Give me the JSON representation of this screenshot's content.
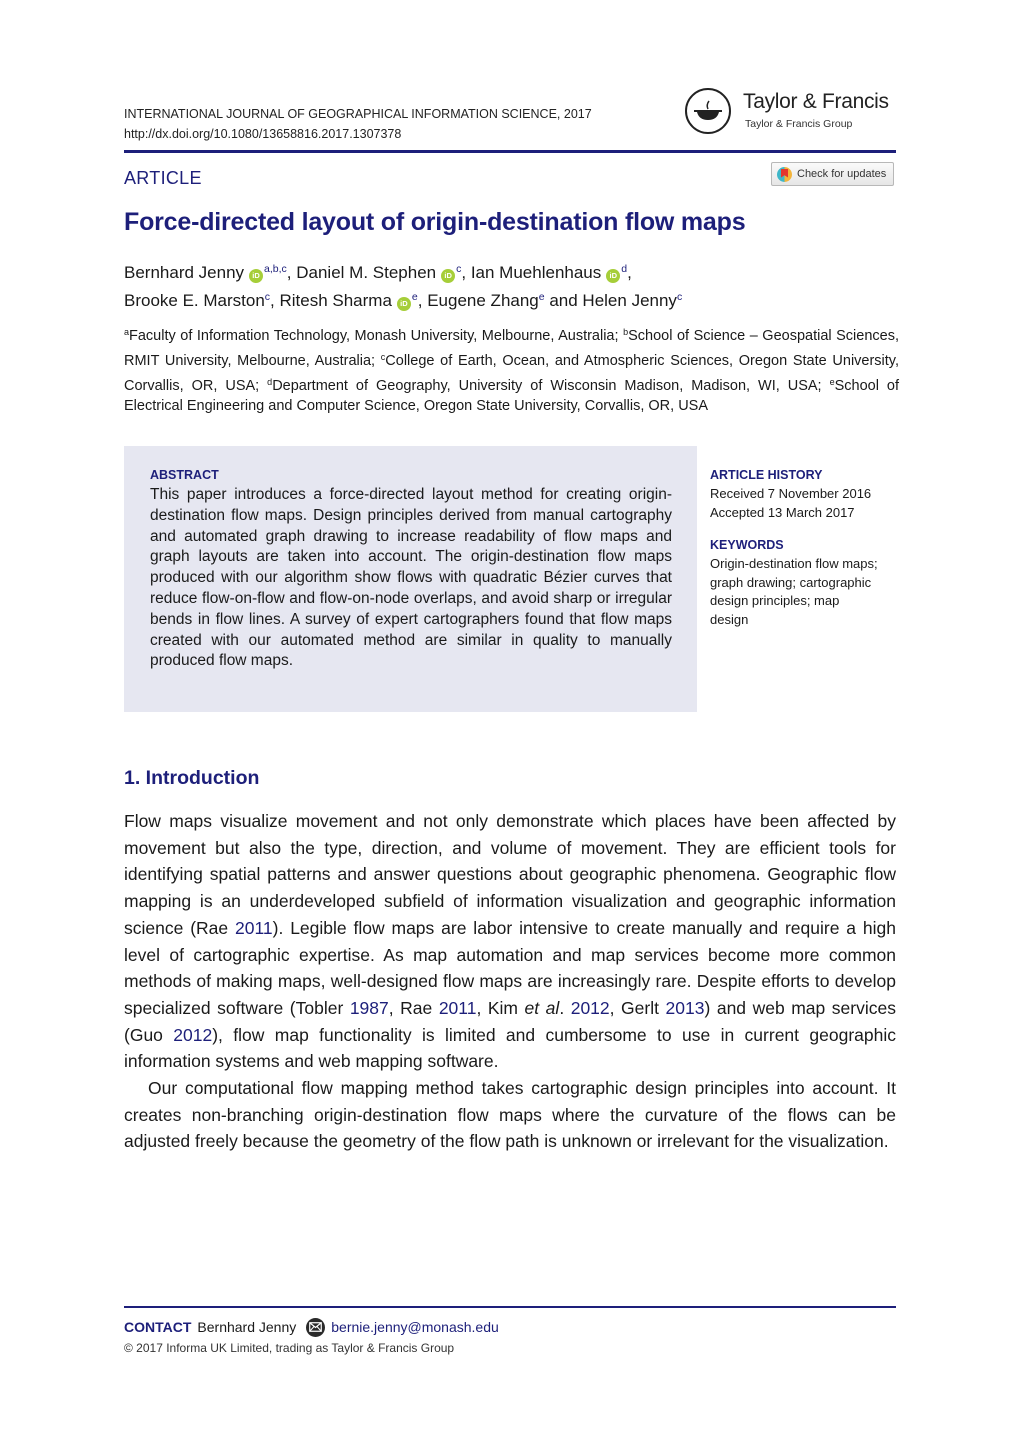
{
  "header": {
    "journal": "INTERNATIONAL JOURNAL OF GEOGRAPHICAL INFORMATION SCIENCE, 2017",
    "doi": "http://dx.doi.org/10.1080/13658816.2017.1307378",
    "publisher": {
      "name": "Taylor & Francis",
      "group": "Taylor & Francis Group",
      "logo_icon": "lamp-icon"
    },
    "article_type": "ARTICLE",
    "check_updates_label": "Check for updates"
  },
  "title": "Force-directed layout of origin-destination flow maps",
  "authors": [
    {
      "name": "Bernhard Jenny",
      "orcid": true,
      "affil": "a,b,c",
      "sep": ", "
    },
    {
      "name": "Daniel M. Stephen",
      "orcid": true,
      "affil": "c",
      "sep": ", "
    },
    {
      "name": "Ian Muehlenhaus",
      "orcid": true,
      "affil": "d",
      "sep": ","
    },
    {
      "name": "Brooke E. Marston",
      "orcid": false,
      "affil": "c",
      "sep": ", "
    },
    {
      "name": "Ritesh Sharma",
      "orcid": true,
      "affil": "e",
      "sep": ", "
    },
    {
      "name": "Eugene Zhang",
      "orcid": false,
      "affil": "e",
      "sep": " and "
    },
    {
      "name": "Helen Jenny",
      "orcid": false,
      "affil": "c",
      "sep": ""
    }
  ],
  "orcid_label": "iD",
  "affiliations": [
    {
      "key": "a",
      "text": "Faculty of Information Technology, Monash University, Melbourne, Australia; "
    },
    {
      "key": "b",
      "text": "School of Science – Geospatial Sciences, RMIT University, Melbourne, Australia; "
    },
    {
      "key": "c",
      "text": "College of Earth, Ocean, and Atmospheric Sciences, Oregon State University, Corvallis, OR, USA; "
    },
    {
      "key": "d",
      "text": "Department of Geography, University of Wisconsin Madison, Madison, WI, USA; "
    },
    {
      "key": "e",
      "text": "School of Electrical Engineering and Computer Science, Oregon State University, Corvallis, OR, USA"
    }
  ],
  "abstract": {
    "heading": "ABSTRACT",
    "text": "This paper introduces a force-directed layout method for creating origin-destination flow maps. Design principles derived from manual cartography and automated graph drawing to increase readability of flow maps and graph layouts are taken into account. The origin-destination flow maps produced with our algorithm show flows with quadratic Bézier curves that reduce flow-on-flow and flow-on-node overlaps, and avoid sharp or irregular bends in flow lines. A survey of expert cartographers found that flow maps created with our automated method are similar in quality to manually produced flow maps."
  },
  "article_history": {
    "heading": "ARTICLE HISTORY",
    "received": "Received 7 November 2016",
    "accepted": "Accepted 13 March 2017"
  },
  "keywords": {
    "heading": "KEYWORDS",
    "text": "Origin-destination flow maps; graph drawing; cartographic design principles; map design"
  },
  "introduction": {
    "heading": "1.  Introduction",
    "paragraphs": [
      [
        {
          "t": "Flow maps visualize movement and not only demonstrate which places have been affected by movement but also the type, direction, and volume of movement. They are efficient tools for identifying spatial patterns and answer questions about geographic phenomena. Geographic flow mapping is an underdeveloped subfield of information visualization and geographic information science (Rae "
        },
        {
          "t": "2011",
          "link": true
        },
        {
          "t": "). Legible flow maps are labor intensive to create manually and require a high level of cartographic expertise. As map automation and map services become more common methods of making maps, well-designed flow maps are increasingly rare. Despite efforts to develop specialized software (Tobler "
        },
        {
          "t": "1987",
          "link": true
        },
        {
          "t": ", Rae "
        },
        {
          "t": "2011",
          "link": true
        },
        {
          "t": ", Kim "
        },
        {
          "t": "et al",
          "italic": true
        },
        {
          "t": ". "
        },
        {
          "t": "2012",
          "link": true
        },
        {
          "t": ", Gerlt "
        },
        {
          "t": "2013",
          "link": true
        },
        {
          "t": ") and web map services (Guo "
        },
        {
          "t": "2012",
          "link": true
        },
        {
          "t": "), flow map functionality is limited and cumbersome to use in current geographic information systems and web mapping software."
        }
      ],
      [
        {
          "t": "Our computational flow mapping method takes cartographic design principles into account. It creates non-branching origin-destination flow maps where the curvature of the flows can be adjusted freely because the geometry of the flow path is unknown or irrelevant for the visualization."
        }
      ]
    ]
  },
  "footer": {
    "contact_label": "CONTACT",
    "contact_name": "Bernhard Jenny",
    "contact_icon": "mail-icon",
    "contact_email": "bernie.jenny@monash.edu",
    "copyright": "© 2017 Informa UK Limited, trading as Taylor & Francis Group"
  },
  "colors": {
    "accent": "#1d1f7a",
    "abstract_bg": "#e6e7f1",
    "orcid": "#a6ce39"
  }
}
